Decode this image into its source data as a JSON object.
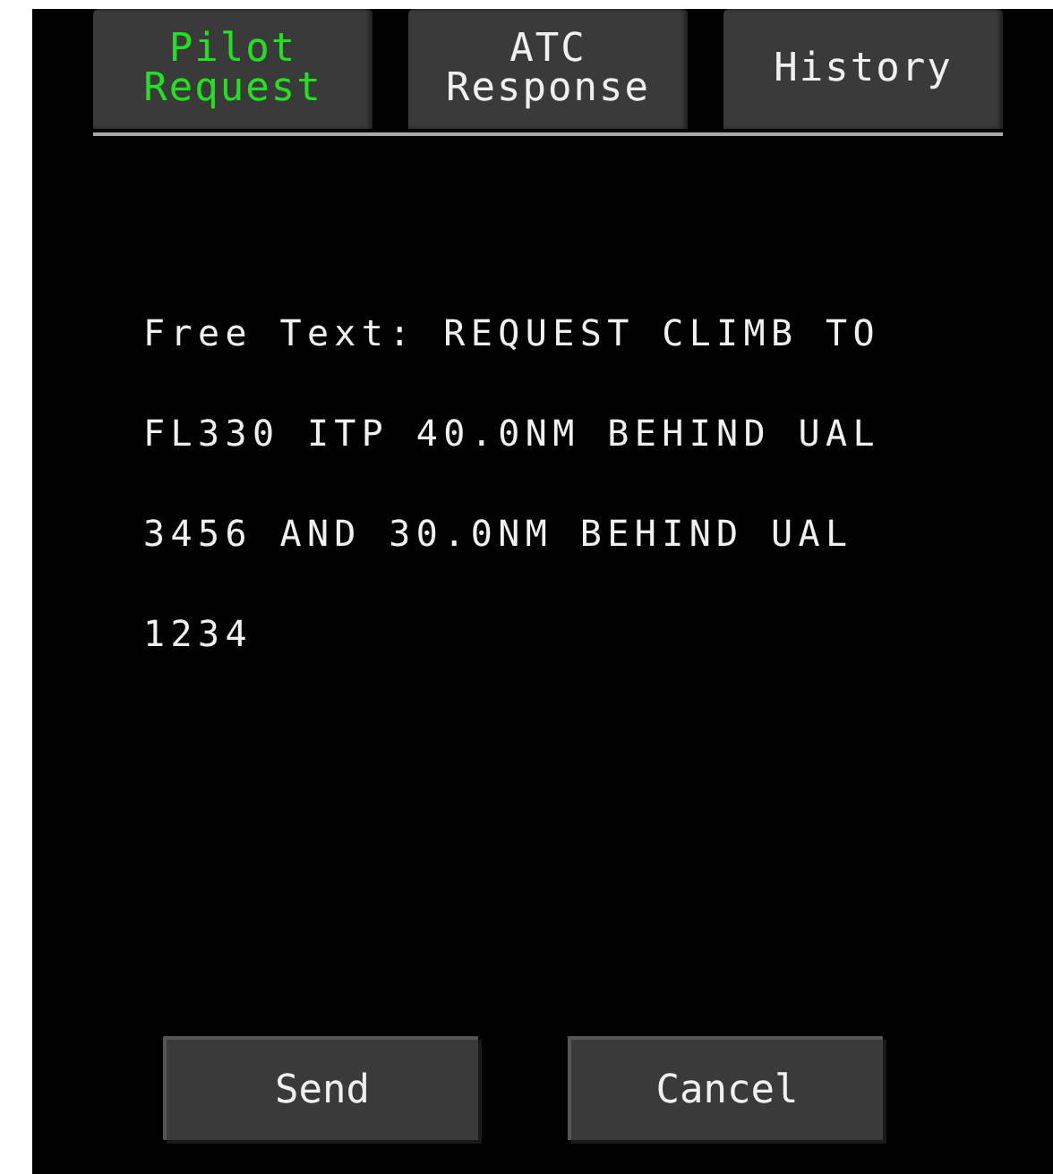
{
  "tabs": [
    {
      "label": "Pilot\nRequest",
      "selected": true
    },
    {
      "label": "ATC\nResponse",
      "selected": false
    },
    {
      "label": "History",
      "selected": false
    }
  ],
  "message": "Free Text: REQUEST CLIMB TO FL330 ITP 40.0NM BEHIND UAL 3456 AND 30.0NM BEHIND UAL 1234",
  "buttons": [
    "Send",
    "Cancel"
  ]
}
